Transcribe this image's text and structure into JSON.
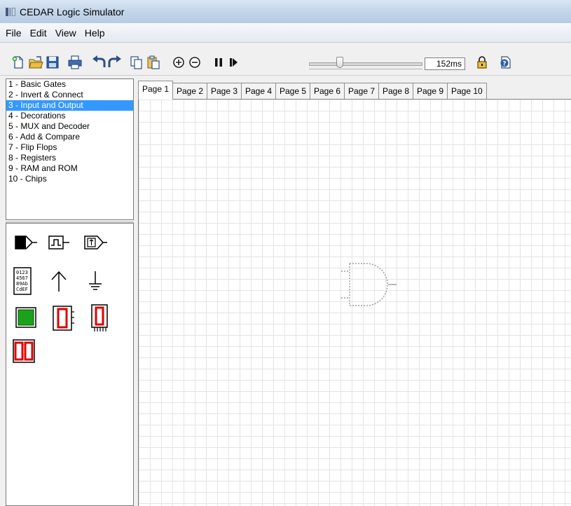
{
  "window": {
    "title": "CEDAR Logic Simulator"
  },
  "menu": [
    {
      "label": "File"
    },
    {
      "label": "Edit"
    },
    {
      "label": "View"
    },
    {
      "label": "Help"
    }
  ],
  "toolbar": {
    "speed_value": "152ms",
    "slider_fraction": 0.27
  },
  "library": {
    "items": [
      {
        "label": "1 - Basic Gates"
      },
      {
        "label": "2 - Invert & Connect"
      },
      {
        "label": "3 - Input and Output"
      },
      {
        "label": "4 - Decorations"
      },
      {
        "label": "5 - MUX and Decoder"
      },
      {
        "label": "6 - Add & Compare"
      },
      {
        "label": "7 - Flip Flops"
      },
      {
        "label": "8 - Registers"
      },
      {
        "label": "9 - RAM and ROM"
      },
      {
        "label": "10 - Chips"
      }
    ],
    "selected_index": 2
  },
  "palette": {
    "hex_display_rows": [
      "0123",
      "4567",
      "89Ab",
      "CdEF"
    ],
    "led_color": "#1aa31a",
    "seven_segment_color": "#e00000"
  },
  "tabs": [
    {
      "label": "Page 1"
    },
    {
      "label": "Page 2"
    },
    {
      "label": "Page 3"
    },
    {
      "label": "Page 4"
    },
    {
      "label": "Page 5"
    },
    {
      "label": "Page 6"
    },
    {
      "label": "Page 7"
    },
    {
      "label": "Page 8"
    },
    {
      "label": "Page 9"
    },
    {
      "label": "Page 10"
    }
  ],
  "active_tab": 0,
  "colors": {
    "selection": "#3399ff",
    "grid_line": "#e4e4e4"
  }
}
